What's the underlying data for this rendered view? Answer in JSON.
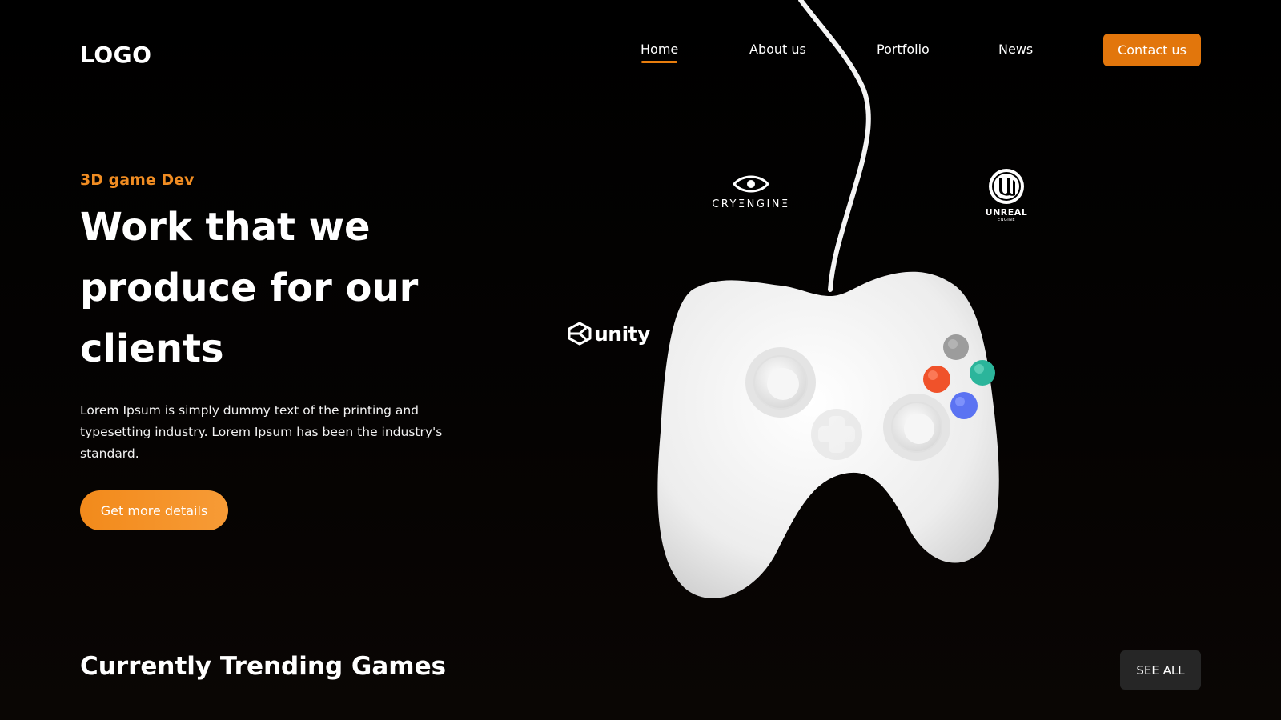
{
  "header": {
    "logo": "LOGO",
    "nav": [
      {
        "label": "Home",
        "active": true
      },
      {
        "label": "About us",
        "active": false
      },
      {
        "label": "Portfolio",
        "active": false
      },
      {
        "label": "News",
        "active": false
      }
    ],
    "contact_label": "Contact us"
  },
  "hero": {
    "eyebrow": "3D game Dev",
    "title": "Work that we produce for our clients",
    "description": "Lorem Ipsum is simply dummy text of the printing and typesetting industry. Lorem Ipsum has been the industry's standard.",
    "cta_label": "Get more details"
  },
  "engines": {
    "cryengine": "CRYΞNGINΞ",
    "unreal": "UNREAL",
    "unreal_sub": "ENGINE",
    "unity": "unity"
  },
  "trending": {
    "title": "Currently Trending Games",
    "see_all_label": "SEE ALL"
  },
  "colors": {
    "accent": "#e2760c",
    "accent_light": "#f08c22",
    "background": "#000000",
    "button_dark": "#262626",
    "face_button_gray": "#9c9c9c",
    "face_button_orange": "#f0522a",
    "face_button_teal": "#2bb59b",
    "face_button_blue": "#5b73f2"
  },
  "icons": {
    "logo": "wordmark",
    "cryengine": "eye-icon",
    "unreal": "unreal-u-icon",
    "unity": "unity-cube-icon",
    "hero_image": "game-controller-icon"
  }
}
